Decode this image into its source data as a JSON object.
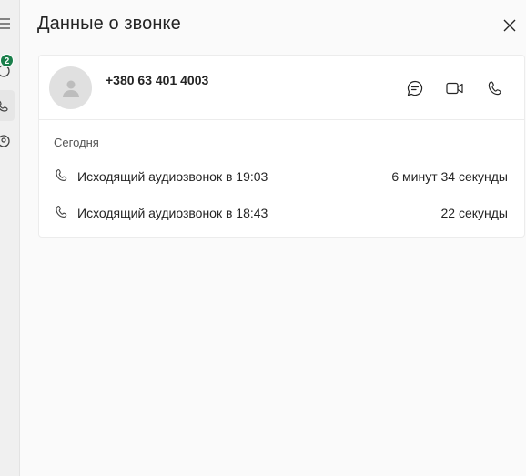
{
  "panel": {
    "title": "Данные о звонке",
    "close_icon": "close-icon"
  },
  "rail": {
    "chat_badge": "2"
  },
  "contact": {
    "phone": "+380 63 401 4003",
    "actions": [
      "chat-icon",
      "video-icon",
      "phone-icon"
    ]
  },
  "history": {
    "section_label": "Сегодня",
    "calls": [
      {
        "description": "Исходящий аудиозвонок в 19:03",
        "duration": "6 минут 34 секунды"
      },
      {
        "description": "Исходящий аудиозвонок в 18:43",
        "duration": "22 секунды"
      }
    ]
  },
  "colors": {
    "badge": "#1a7f4b",
    "panel_bg": "#fafafa",
    "card_bg": "#ffffff"
  }
}
